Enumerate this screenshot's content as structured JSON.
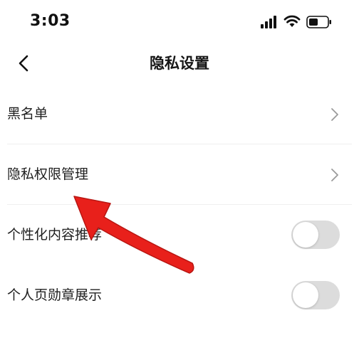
{
  "status_bar": {
    "time": "3:03",
    "icons": [
      "signal-icon",
      "wifi-icon",
      "battery-icon"
    ]
  },
  "nav": {
    "back_icon": "chevron-left-icon",
    "title": "隐私设置"
  },
  "settings": {
    "items": [
      {
        "label": "黑名单",
        "control": "chevron"
      },
      {
        "label": "隐私权限管理",
        "control": "chevron"
      },
      {
        "label": "个性化内容推荐",
        "control": "toggle",
        "on": false
      },
      {
        "label": "个人页勋章展示",
        "control": "toggle",
        "on": false
      }
    ]
  },
  "annotation": {
    "icon": "red-arrow-icon",
    "color": "#e8201b"
  },
  "colors": {
    "toggle_off": "#dcdcdc",
    "divider": "#efefef",
    "chevron": "#9a9a9a"
  }
}
